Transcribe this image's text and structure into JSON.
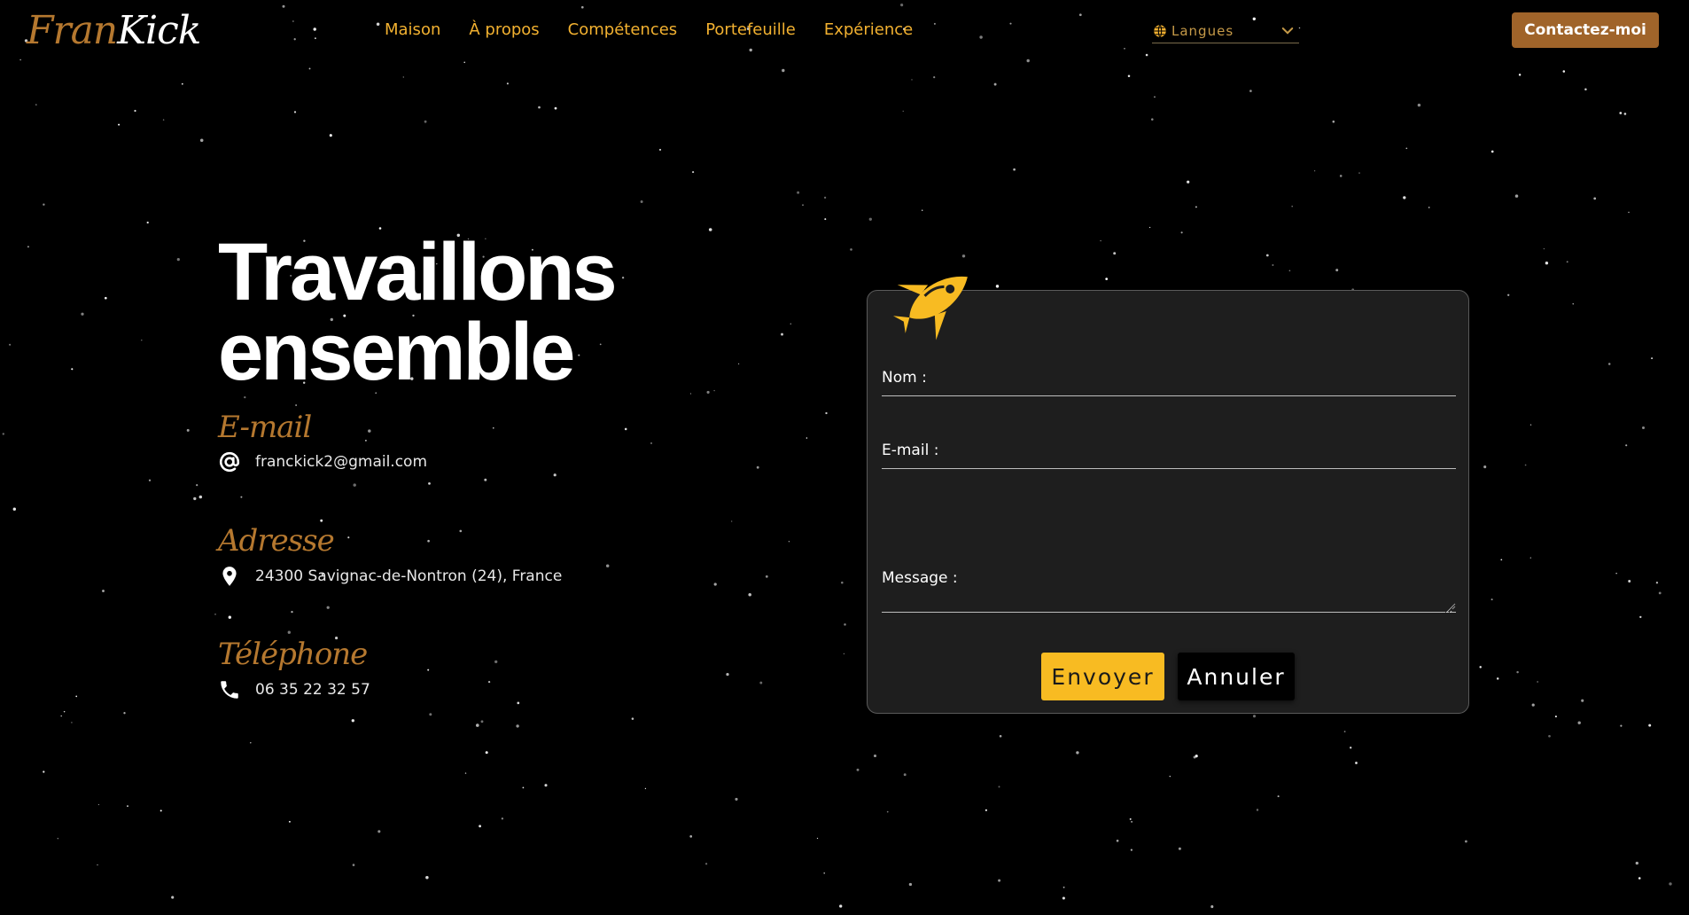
{
  "header": {
    "logo_part1": "Fran",
    "logo_part2": "Kick",
    "nav": [
      {
        "label": "Maison"
      },
      {
        "label": "À propos"
      },
      {
        "label": "Compétences"
      },
      {
        "label": "Portefeuille"
      },
      {
        "label": "Expérience"
      }
    ],
    "language": {
      "label": "Langues",
      "icon": "globe-icon"
    },
    "contact_button": "Contactez-moi"
  },
  "hero": {
    "title_line1": "Travaillons",
    "title_line2": "ensemble"
  },
  "contact_info": {
    "email": {
      "heading": "E-mail",
      "value": "franckick2@gmail.com",
      "icon": "at-icon"
    },
    "address": {
      "heading": "Adresse",
      "value": "24300 Savignac-de-Nontron (24), France",
      "icon": "location-pin-icon"
    },
    "phone": {
      "heading": "Téléphone",
      "value": "06 35 22 32 57",
      "icon": "phone-icon"
    }
  },
  "form": {
    "name_label": "Nom :",
    "name_value": "",
    "email_label": "E-mail :",
    "email_value": "",
    "message_label": "Message :",
    "message_value": "",
    "send_label": "Envoyer",
    "cancel_label": "Annuler"
  },
  "colors": {
    "accent": "#f2b130",
    "brand_brown": "#a0642a",
    "send_button": "#f8bb22",
    "background": "#000000",
    "card": "#1e1e1e"
  }
}
